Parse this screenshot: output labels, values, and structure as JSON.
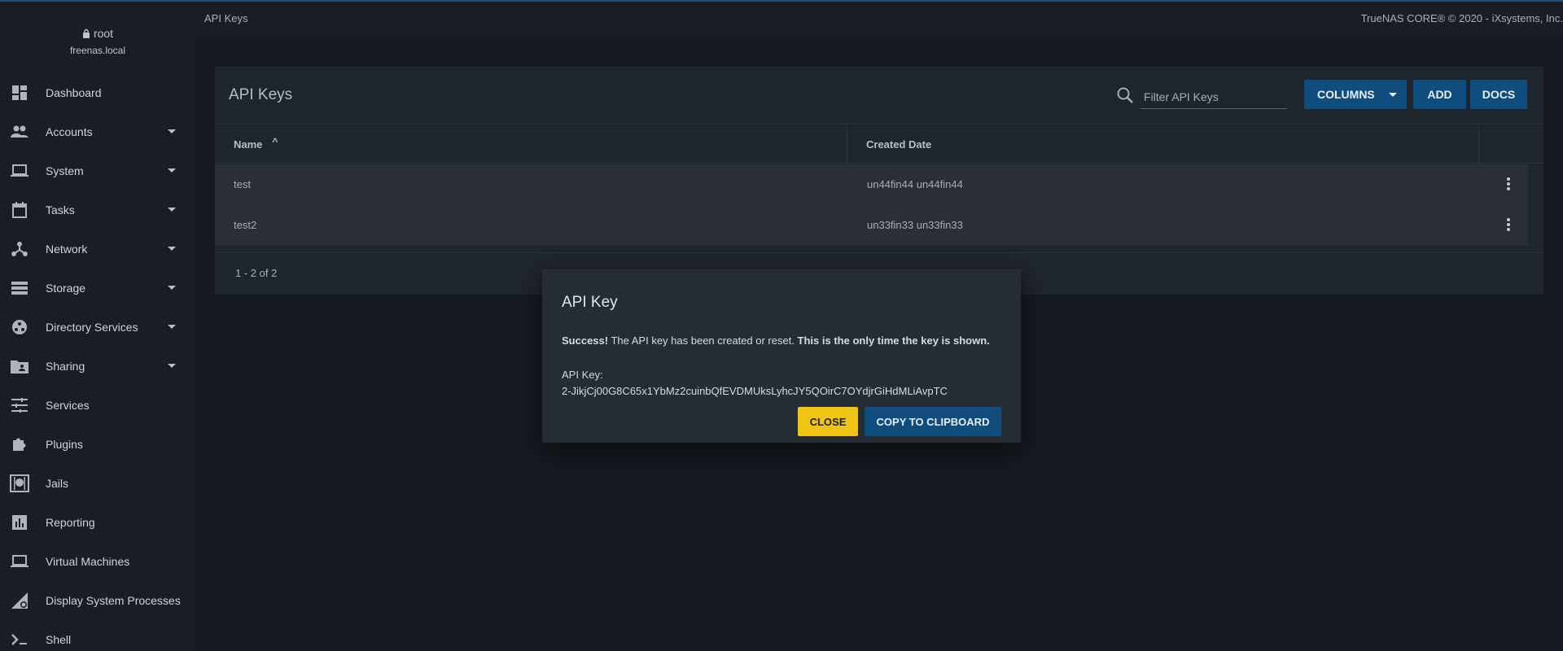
{
  "user": {
    "name": "root",
    "host": "freenas.local"
  },
  "sidebar": {
    "items": [
      {
        "label": "Dashboard",
        "icon": "dashboard-icon",
        "expandable": false
      },
      {
        "label": "Accounts",
        "icon": "people-icon",
        "expandable": true
      },
      {
        "label": "System",
        "icon": "laptop-icon",
        "expandable": true
      },
      {
        "label": "Tasks",
        "icon": "calendar-icon",
        "expandable": true
      },
      {
        "label": "Network",
        "icon": "network-icon",
        "expandable": true
      },
      {
        "label": "Storage",
        "icon": "storage-icon",
        "expandable": true
      },
      {
        "label": "Directory Services",
        "icon": "directory-icon",
        "expandable": true
      },
      {
        "label": "Sharing",
        "icon": "folder-share-icon",
        "expandable": true
      },
      {
        "label": "Services",
        "icon": "tune-icon",
        "expandable": false
      },
      {
        "label": "Plugins",
        "icon": "puzzle-icon",
        "expandable": false
      },
      {
        "label": "Jails",
        "icon": "jail-icon",
        "expandable": false
      },
      {
        "label": "Reporting",
        "icon": "chart-icon",
        "expandable": false
      },
      {
        "label": "Virtual Machines",
        "icon": "laptop-icon",
        "expandable": false
      },
      {
        "label": "Display System Processes",
        "icon": "processes-icon",
        "expandable": false
      },
      {
        "label": "Shell",
        "icon": "shell-icon",
        "expandable": false
      }
    ]
  },
  "topbar": {
    "breadcrumb": "API Keys",
    "copyright": "TrueNAS CORE® © 2020 - iXsystems, Inc."
  },
  "card": {
    "title": "API Keys",
    "filter_placeholder": "Filter API Keys",
    "columns_label": "COLUMNS",
    "add_label": "ADD",
    "docs_label": "DOCS",
    "headers": {
      "name": "Name",
      "date": "Created Date",
      "sort_indicator": "^"
    },
    "rows": [
      {
        "name": "test",
        "date": "un44fin44 un44fin44"
      },
      {
        "name": "test2",
        "date": "un33fin33 un33fin33"
      }
    ],
    "pager": "1 - 2 of 2"
  },
  "dialog": {
    "title": "API Key",
    "success_bold": "Success!",
    "success_text": " The API key has been created or reset. ",
    "warning_bold": "This is the only time the key is shown.",
    "key_label": "API Key:",
    "key_value": "2-JikjCj00G8C65x1YbMz2cuinbQfEVDMUksLyhcJY5QOirC7OYdjrGiHdMLiAvpTC",
    "close_label": "CLOSE",
    "copy_label": "COPY TO CLIPBOARD"
  },
  "colors": {
    "accent": "#0f4d7e",
    "warning": "#f0c414",
    "background": "#151a21",
    "sidebar": "#1a1e24"
  }
}
